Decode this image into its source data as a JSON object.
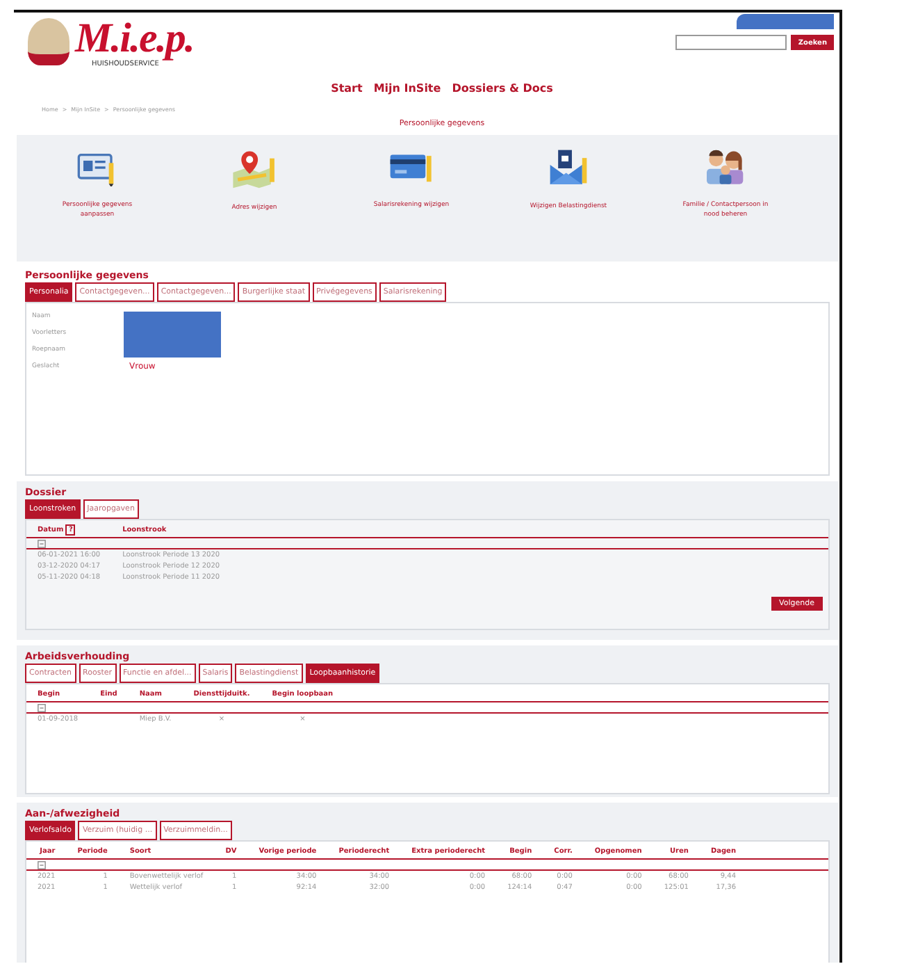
{
  "header": {
    "brand": "M.i.e.p.",
    "brand_subtitle": "HUISHOUDSERVICE",
    "search": {
      "button": "Zoeken"
    }
  },
  "nav": [
    {
      "label": "Start"
    },
    {
      "label": "Mijn InSite"
    },
    {
      "label": "Dossiers & Docs"
    }
  ],
  "breadcrumb": {
    "separator": ">",
    "items": [
      "Home",
      "Mijn InSite",
      "Persoonlijke gegevens"
    ]
  },
  "page_title": "Persoonlijke gegevens",
  "quick_actions": [
    {
      "label": "Persoonlijke gegevens aanpassen"
    },
    {
      "label": "Adres wijzigen"
    },
    {
      "label": "Salarisrekening wijzigen"
    },
    {
      "label": "Wijzigen Belastingdienst"
    },
    {
      "label": "Familie / Contactpersoon in nood beheren"
    }
  ],
  "sections": [
    {
      "kind": "fields",
      "title": "Persoonlijke gegevens",
      "tabs": [
        {
          "label": "Personalia",
          "selected": true
        },
        {
          "label": "Contactgegeven...",
          "selected": false
        },
        {
          "label": "Contactgegeven...",
          "selected": false
        },
        {
          "label": "Burgerlijke staat",
          "selected": false
        },
        {
          "label": "Privégegevens",
          "selected": false
        },
        {
          "label": "Salarisrekening",
          "selected": false
        }
      ],
      "fields": [
        {
          "label": "Naam"
        },
        {
          "label": "Voorletters"
        },
        {
          "label": "Roepnaam"
        },
        {
          "label": "Geslacht",
          "value": "Vrouw"
        }
      ]
    },
    {
      "kind": "table",
      "title": "Dossier",
      "tabs": [
        {
          "label": "Loonstroken",
          "selected": true
        },
        {
          "label": "Jaaropgaven",
          "selected": false
        }
      ],
      "columns": [
        {
          "label": "Datum",
          "help_mark": "?"
        },
        {
          "label": "Loonstrook"
        }
      ],
      "rows": [
        [
          "06-01-2021 16:00",
          "Loonstrook Periode 13 2020"
        ],
        [
          "03-12-2020 04:17",
          "Loonstrook Periode 12 2020"
        ],
        [
          "05-11-2020 04:18",
          "Loonstrook Periode 11 2020"
        ]
      ],
      "next_button": "Volgende"
    },
    {
      "kind": "table",
      "title": "Arbeidsverhouding",
      "tabs": [
        {
          "label": "Contracten",
          "selected": false
        },
        {
          "label": "Rooster",
          "selected": false
        },
        {
          "label": "Functie en afdel...",
          "selected": false
        },
        {
          "label": "Salaris",
          "selected": false
        },
        {
          "label": "Belastingdienst",
          "selected": false
        },
        {
          "label": "Loopbaanhistorie",
          "selected": true
        }
      ],
      "columns": [
        {
          "label": "Begin"
        },
        {
          "label": "Eind"
        },
        {
          "label": "Naam"
        },
        {
          "label": "Diensttijduitk."
        },
        {
          "label": "Begin loopbaan"
        }
      ],
      "rows": [
        [
          "01-09-2018",
          "",
          "Miep B.V.",
          "×",
          "×"
        ]
      ]
    },
    {
      "kind": "table",
      "title": "Aan-/afwezigheid",
      "tabs": [
        {
          "label": "Verlofsaldo",
          "selected": true
        },
        {
          "label": "Verzuim (huidig ...",
          "selected": false
        },
        {
          "label": "Verzuimmeldin...",
          "selected": false
        }
      ],
      "columns": [
        {
          "label": "Jaar"
        },
        {
          "label": "Periode"
        },
        {
          "label": "Soort"
        },
        {
          "label": "DV"
        },
        {
          "label": "Vorige periode"
        },
        {
          "label": "Perioderecht"
        },
        {
          "label": "Extra perioderecht"
        },
        {
          "label": "Begin"
        },
        {
          "label": "Corr."
        },
        {
          "label": "Opgenomen"
        },
        {
          "label": "Uren"
        },
        {
          "label": "Dagen"
        }
      ],
      "rows": [
        [
          "2021",
          "1",
          "Bovenwettelijk verlof",
          "1",
          "34:00",
          "34:00",
          "0:00",
          "68:00",
          "0:00",
          "0:00",
          "68:00",
          "9,44"
        ],
        [
          "2021",
          "1",
          "Wettelijk verlof",
          "1",
          "92:14",
          "32:00",
          "0:00",
          "124:14",
          "0:47",
          "0:00",
          "125:01",
          "17,36"
        ]
      ]
    }
  ]
}
